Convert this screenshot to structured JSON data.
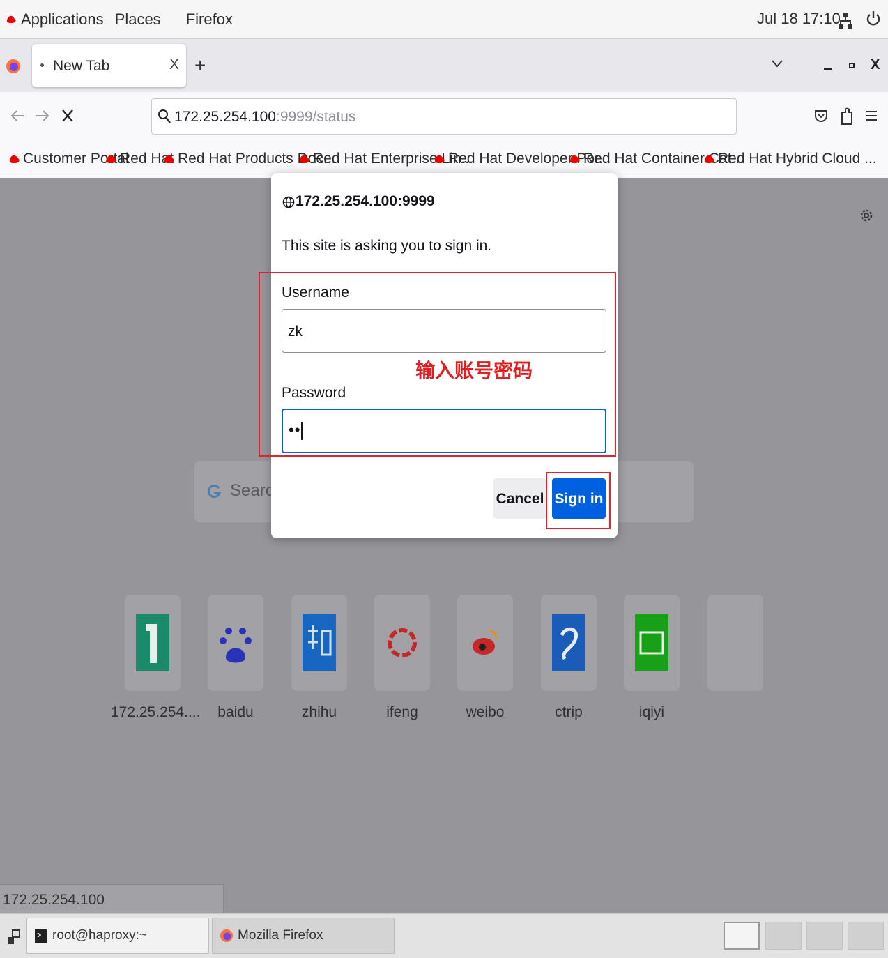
{
  "topbar": {
    "applications": "Applications",
    "places": "Places",
    "firefox": "Firefox",
    "clock": "Jul 18  17:10"
  },
  "tabs": [
    {
      "title": "New Tab",
      "close": "X"
    }
  ],
  "newtab_label": "+",
  "window_close": "X",
  "urlbar": {
    "host": "172.25.254.100",
    "rest": ":9999/status"
  },
  "bookmarks": [
    "Customer Portal",
    "Red Hat",
    "Red Hat Products Doc...",
    "Red Hat Enterprise Lin...",
    "Red Hat Developer Por...",
    "Red Hat Container Cat...",
    "Red Hat Hybrid Cloud ..."
  ],
  "newtab_page": {
    "search_placeholder": "Search",
    "tiles": [
      {
        "label": "172.25.254....",
        "icon": "172-tile-icon"
      },
      {
        "label": "baidu",
        "icon": "baidu-icon"
      },
      {
        "label": "zhihu",
        "icon": "zhihu-icon"
      },
      {
        "label": "ifeng",
        "icon": "ifeng-icon"
      },
      {
        "label": "weibo",
        "icon": "weibo-icon"
      },
      {
        "label": "ctrip",
        "icon": "ctrip-icon"
      },
      {
        "label": "iqiyi",
        "icon": "iqiyi-icon"
      },
      {
        "label": "",
        "icon": "empty-tile"
      }
    ]
  },
  "status_link": "172.25.254.100",
  "dialog": {
    "host": "172.25.254.100:9999",
    "message": "This site is asking you to sign in.",
    "username_label": "Username",
    "username_value": "zk",
    "password_label": "Password",
    "password_value": "••",
    "cancel": "Cancel",
    "signin": "Sign in"
  },
  "annotation": "输入账号密码",
  "taskbar": {
    "items": [
      {
        "label": "root@haproxy:~"
      },
      {
        "label": "Mozilla Firefox"
      }
    ]
  },
  "colors": {
    "accent": "#0061e0",
    "annotation_red": "#e0242c",
    "overlay": "#96969a"
  }
}
